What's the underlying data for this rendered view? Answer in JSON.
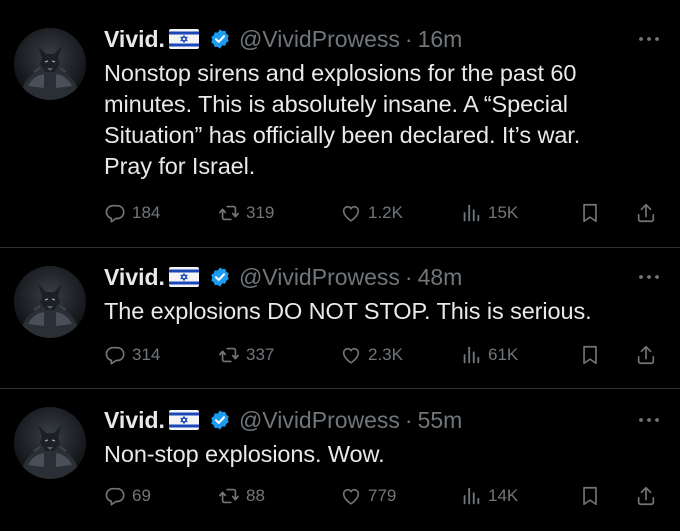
{
  "tweets": [
    {
      "name": "Vivid.",
      "handle": "@VividProwess",
      "time": "16m",
      "text": [
        "Nonstop sirens and explosions for the past 60",
        "minutes. This is absolutely insane. A “Special",
        "Situation” has officially been declared. It’s war.",
        "Pray for Israel."
      ],
      "replies": "184",
      "retweets": "319",
      "likes": "1.2K",
      "views": "15K"
    },
    {
      "name": "Vivid.",
      "handle": "@VividProwess",
      "time": "48m",
      "text": [
        "The explosions DO NOT STOP. This is serious."
      ],
      "replies": "314",
      "retweets": "337",
      "likes": "2.3K",
      "views": "61K"
    },
    {
      "name": "Vivid.",
      "handle": "@VividProwess",
      "time": "55m",
      "text": [
        "Non-stop explosions. Wow."
      ],
      "replies": "69",
      "retweets": "88",
      "likes": "779",
      "views": "14K"
    }
  ],
  "icons": {
    "reply": "reply-icon",
    "retweet": "retweet-icon",
    "like": "heart-icon",
    "views": "views-icon",
    "bookmark": "bookmark-icon",
    "share": "share-icon",
    "verified": "verified-badge-icon",
    "flag": "israel-flag-icon",
    "more": "more-options-icon"
  },
  "colors": {
    "background": "#000000",
    "text": "#e7e9ea",
    "muted": "#71767b",
    "verified": "#1d9bf0",
    "divider": "#2f3336"
  }
}
